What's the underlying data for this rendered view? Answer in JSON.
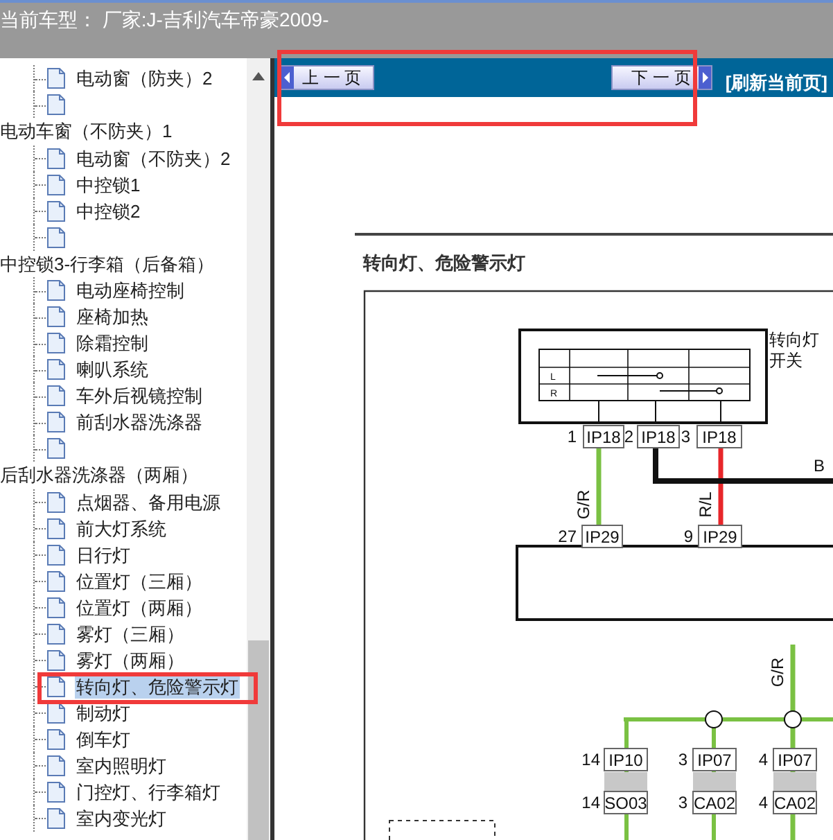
{
  "header": {
    "title": "当前车型： 厂家:J-吉利汽车帝豪2009-"
  },
  "tree": {
    "items": [
      {
        "kind": "leaf",
        "label": "电动窗（防夹）2",
        "selected": false
      },
      {
        "kind": "wrapped",
        "label": "电动车窗（不防夹）1",
        "selected": false
      },
      {
        "kind": "leaf",
        "label": "电动窗（不防夹）2",
        "selected": false
      },
      {
        "kind": "leaf",
        "label": "中控锁1",
        "selected": false
      },
      {
        "kind": "leaf",
        "label": "中控锁2",
        "selected": false
      },
      {
        "kind": "wrapped",
        "label": "中控锁3-行李箱（后备箱）",
        "selected": false
      },
      {
        "kind": "leaf",
        "label": "电动座椅控制",
        "selected": false
      },
      {
        "kind": "leaf",
        "label": "座椅加热",
        "selected": false
      },
      {
        "kind": "leaf",
        "label": "除霜控制",
        "selected": false
      },
      {
        "kind": "leaf",
        "label": "喇叭系统",
        "selected": false
      },
      {
        "kind": "leaf",
        "label": "车外后视镜控制",
        "selected": false
      },
      {
        "kind": "leaf",
        "label": "前刮水器洗涤器",
        "selected": false
      },
      {
        "kind": "wrapped",
        "label": "后刮水器洗涤器（两厢）",
        "selected": false
      },
      {
        "kind": "leaf",
        "label": "点烟器、备用电源",
        "selected": false
      },
      {
        "kind": "leaf",
        "label": "前大灯系统",
        "selected": false
      },
      {
        "kind": "leaf",
        "label": "日行灯",
        "selected": false
      },
      {
        "kind": "leaf",
        "label": "位置灯（三厢）",
        "selected": false
      },
      {
        "kind": "leaf",
        "label": "位置灯（两厢）",
        "selected": false
      },
      {
        "kind": "leaf",
        "label": "雾灯（三厢）",
        "selected": false
      },
      {
        "kind": "leaf",
        "label": "雾灯（两厢）",
        "selected": false
      },
      {
        "kind": "leaf",
        "label": "转向灯、危险警示灯",
        "selected": true
      },
      {
        "kind": "leaf",
        "label": "制动灯",
        "selected": false
      },
      {
        "kind": "leaf",
        "label": "倒车灯",
        "selected": false
      },
      {
        "kind": "leaf",
        "label": "室内照明灯",
        "selected": false
      },
      {
        "kind": "leaf",
        "label": "门控灯、行李箱灯",
        "selected": false
      },
      {
        "kind": "leaf",
        "label": "室内变光灯",
        "selected": false
      }
    ]
  },
  "toolbar": {
    "prev": "上 一 页",
    "next": "下 一 页",
    "refresh": "[刷新当前页]"
  },
  "document": {
    "title": "转向灯、危险警示灯",
    "diagram": {
      "switch": {
        "label": [
          "转向灯",
          "开关"
        ],
        "positions": [
          "L",
          "R"
        ]
      },
      "connectors": [
        {
          "pin": "1",
          "name": "IP18"
        },
        {
          "pin": "2",
          "name": "IP18"
        },
        {
          "pin": "3",
          "name": "IP18"
        },
        {
          "pin": "27",
          "name": "IP29"
        },
        {
          "pin": "9",
          "name": "IP29"
        },
        {
          "pin": "14",
          "name": "IP10"
        },
        {
          "pin": "14",
          "name": "SO03"
        },
        {
          "pin": "3",
          "name": "IP07"
        },
        {
          "pin": "3",
          "name": "CA02"
        },
        {
          "pin": "4",
          "name": "IP07"
        },
        {
          "pin": "4",
          "name": "CA02"
        }
      ],
      "wires": [
        {
          "label": "G/R",
          "color": "#7ac143"
        },
        {
          "label": "R/L",
          "color": "#e8262a"
        },
        {
          "label": "B",
          "color": "#111111"
        },
        {
          "label": "G/R",
          "color": "#7ac143"
        }
      ]
    }
  }
}
